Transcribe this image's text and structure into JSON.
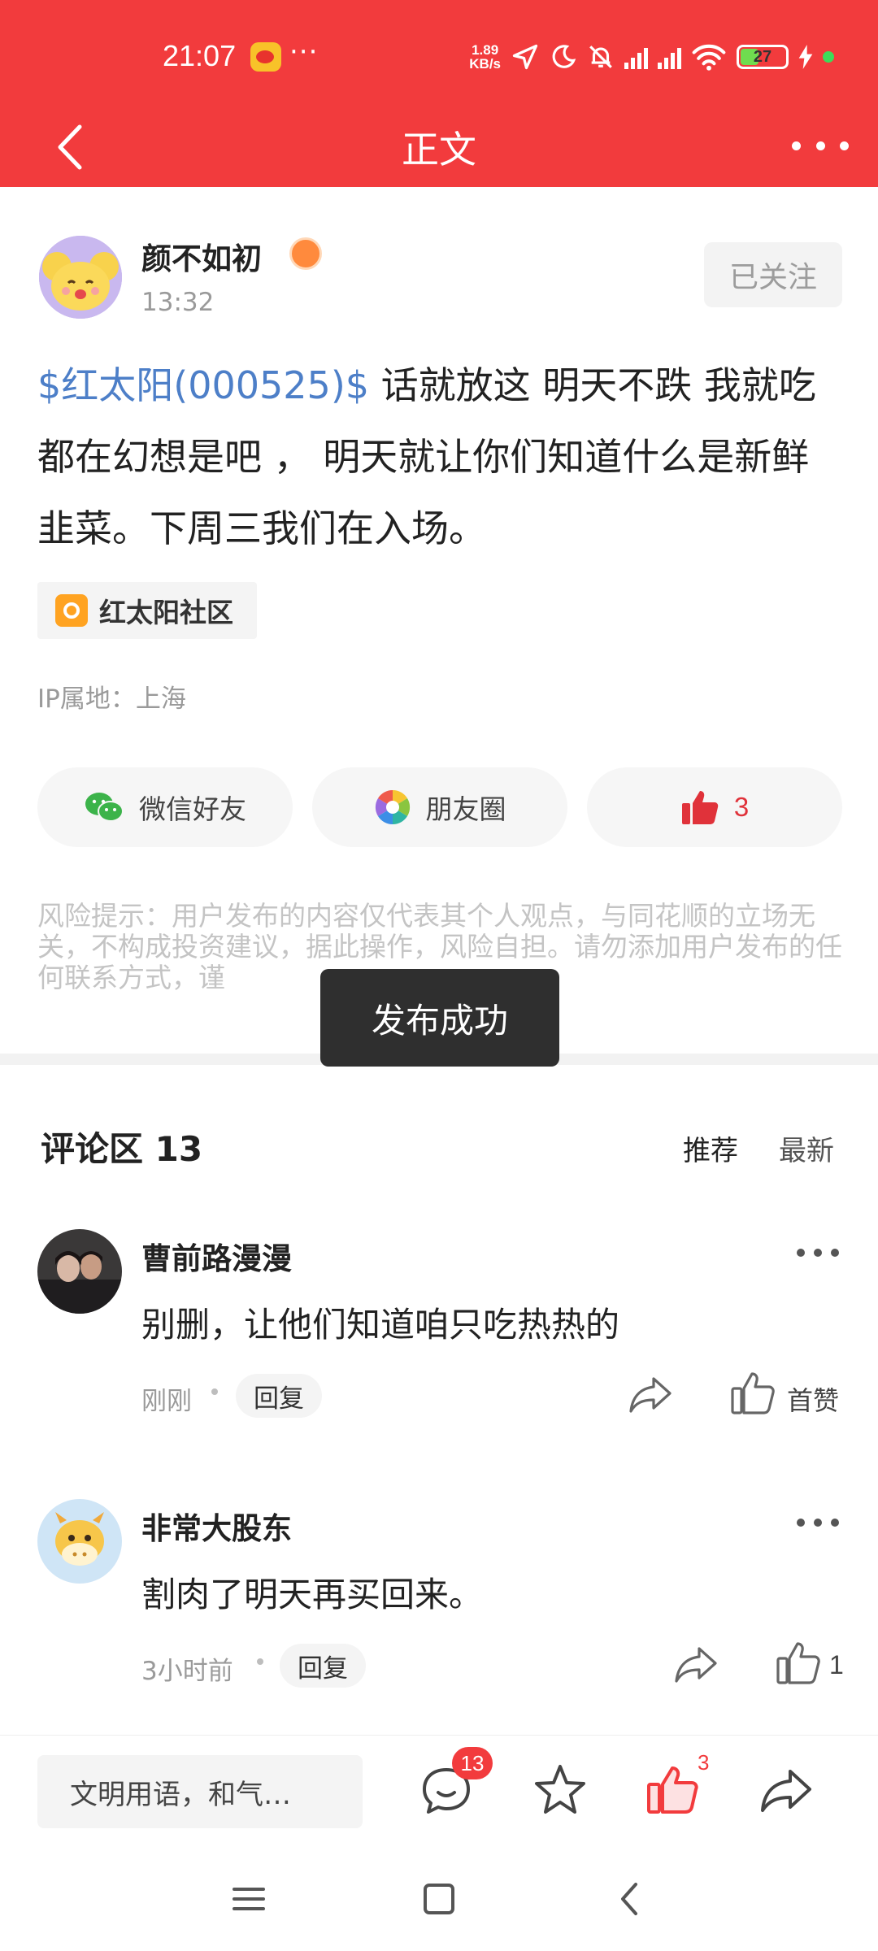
{
  "status_bar": {
    "time": "21:07",
    "overflow": "···",
    "speed_value": "1.89",
    "speed_unit": "KB/s",
    "battery": "27"
  },
  "header": {
    "title": "正文"
  },
  "post": {
    "author": "颜不如初",
    "time": "13:32",
    "follow_label": "已关注",
    "stock_link": "$红太阳(000525)$",
    "body": " 话就放这 明天不跌 我就吃 都在幻想是吧 ， 明天就让你们知道什么是新鲜韭菜。下周三我们在入场。",
    "community": "红太阳社区",
    "ip_location": "IP属地：上海",
    "share_wechat": "微信好友",
    "share_moments": "朋友圈",
    "like_count": "3",
    "risk_notice": "风险提示：用户发布的内容仅代表其个人观点，与同花顺的立场无关，不构成投资建议，据此操作，风险自担。请勿添加用户发布的任何联系方式，谨"
  },
  "toast": "发布成功",
  "comments_section": {
    "title": "评论区 13",
    "sort_recommended": "推荐",
    "sort_latest": "最新",
    "items": [
      {
        "user": "曹前路漫漫",
        "text": "别删，让他们知道咱只吃热热的",
        "time": "刚刚",
        "reply": "回复",
        "like": "首赞"
      },
      {
        "user": "非常大股东",
        "text": "割肉了明天再买回来。",
        "time": "3小时前",
        "reply": "回复",
        "like": "1"
      }
    ]
  },
  "bottom_bar": {
    "input_placeholder": "文明用语，和气…",
    "comment_badge": "13",
    "like_badge": "3"
  },
  "colors": {
    "brand_red": "#f23b3d",
    "link_blue": "#4d7fc8"
  },
  "icons": [
    "back-arrow-icon",
    "more-icon",
    "wechat-icon",
    "moments-icon",
    "thumb-up-icon",
    "comment-icon",
    "star-icon",
    "share-icon",
    "menu-icon",
    "home-icon",
    "back-icon"
  ]
}
